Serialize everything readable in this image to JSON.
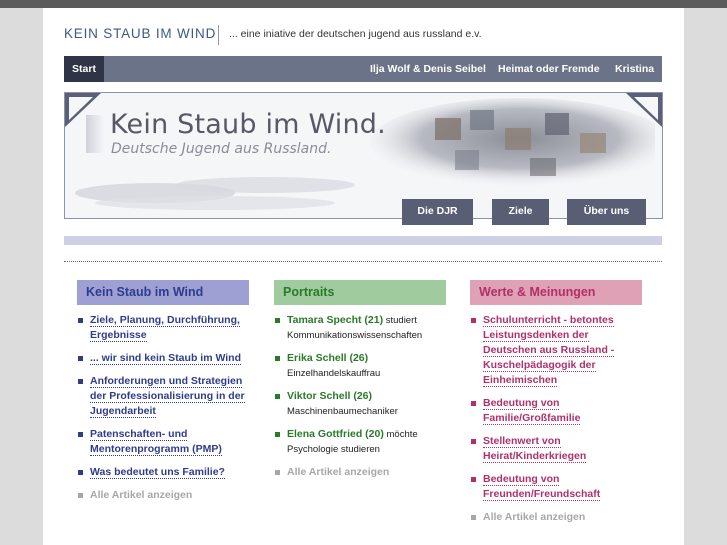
{
  "header": {
    "site_title": "KEIN STAUB IM WIND",
    "tagline": "... eine iniative der deutschen jugend aus russland e.v."
  },
  "nav": {
    "start": "Start",
    "items": [
      "Ilja Wolf & Denis Seibel",
      "Heimat oder Fremde",
      "Kristina"
    ]
  },
  "banner": {
    "title": "Kein Staub im Wind.",
    "subtitle": "Deutsche Jugend aus Russland.",
    "buttons": [
      "Die DJR",
      "Ziele",
      "Über uns"
    ]
  },
  "columns": {
    "left": {
      "heading": "Kein Staub im Wind",
      "items": [
        "Ziele, Planung, Durchführung, Ergebnisse",
        "... wir sind kein Staub im Wind",
        "Anforderungen und Strategien der Professionalisierung in der Jugendarbeit",
        "Patenschaften- und Mentorenprogramm (PMP)",
        "Was bedeutet uns Familie?"
      ],
      "more": "Alle Artikel anzeigen"
    },
    "middle": {
      "heading": "Portraits",
      "items": [
        {
          "name": "Tamara Specht (21)",
          "text1": " studiert",
          "text2": "Kommunikationswissenschaften"
        },
        {
          "name": "Erika Schell (26)",
          "text1": "",
          "text2": "Einzelhandelskauffrau"
        },
        {
          "name": "Viktor Schell (26)",
          "text1": "",
          "text2": "Maschinenbaumechaniker"
        },
        {
          "name": "Elena Gottfried (20)",
          "text1": " möchte",
          "text2": "Psychologie studieren"
        }
      ],
      "more": "Alle Artikel anzeigen"
    },
    "right": {
      "heading": "Werte & Meinungen",
      "items": [
        "Schulunterricht - betontes Leistungsdenken der Deutschen aus Russland - Kuschelpädagogik der Einheimischen",
        "Bedeutung von Familie/Großfamilie",
        "Stellenwert von Heirat/Kinderkriegen",
        "Bedeutung von Freunden/Freundschaft"
      ],
      "more": "Alle Artikel anzeigen"
    }
  },
  "colors": {
    "left_head_bg": "#9ea0d3",
    "left_link": "#2e3c8c",
    "middle_head_bg": "#9fcb9f",
    "middle_link": "#2a7a2a",
    "right_head_bg": "#dfa1b5",
    "right_link": "#b0306a"
  }
}
